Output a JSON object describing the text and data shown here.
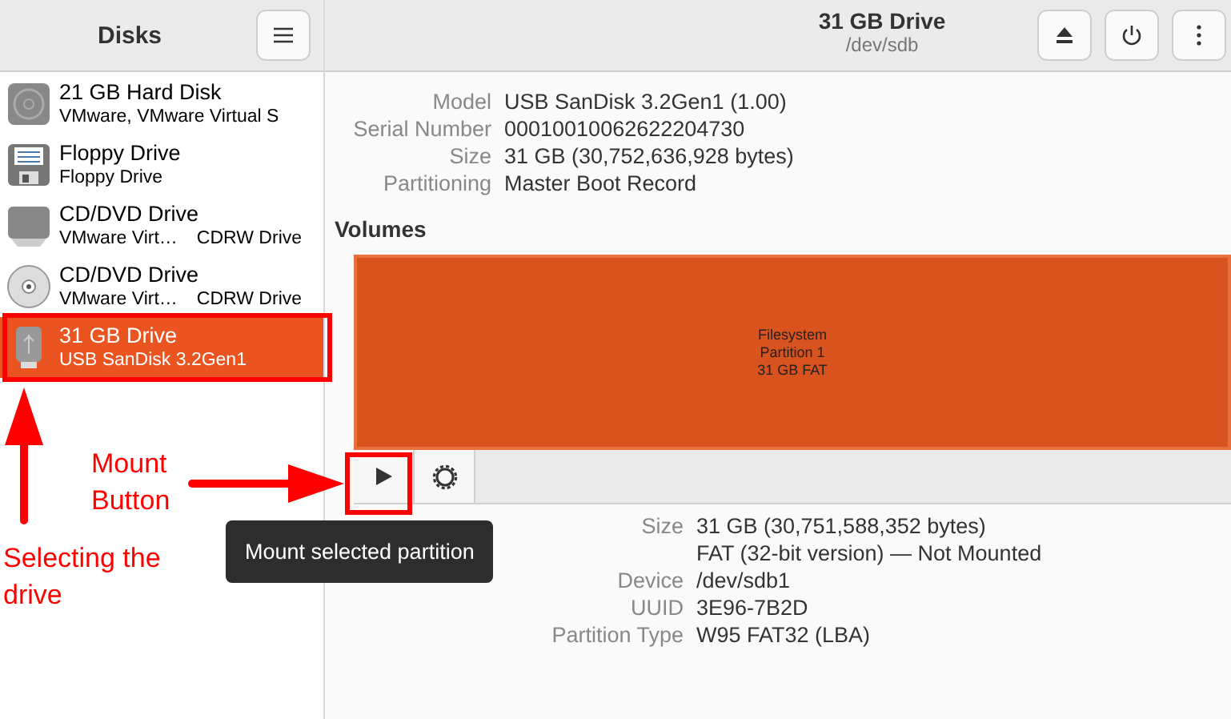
{
  "sidebar": {
    "title": "Disks",
    "items": [
      {
        "kind": "disk",
        "name": "21 GB Hard Disk",
        "subtitle": "VMware, VMware Virtual S",
        "selected": false
      },
      {
        "kind": "floppy",
        "name": "Floppy Drive",
        "subtitle": "Floppy Drive",
        "selected": false
      },
      {
        "kind": "tray",
        "name": "CD/DVD Drive",
        "subtitle": "VMware Virt…",
        "subtitle_2": "CDRW Drive",
        "selected": false
      },
      {
        "kind": "disc",
        "name": "CD/DVD Drive",
        "subtitle": "VMware Virt…",
        "subtitle_2": "CDRW Drive",
        "selected": false
      },
      {
        "kind": "usb",
        "name": "31 GB Drive",
        "subtitle": "USB SanDisk 3.2Gen1",
        "selected": true
      }
    ]
  },
  "header": {
    "title": "31 GB Drive",
    "subtitle": "/dev/sdb"
  },
  "drive_info": [
    {
      "label": "Model",
      "value": "USB SanDisk 3.2Gen1 (1.00)"
    },
    {
      "label": "Serial Number",
      "value": "00010010062622204730"
    },
    {
      "label": "Size",
      "value": "31 GB (30,752,636,928 bytes)"
    },
    {
      "label": "Partitioning",
      "value": "Master Boot Record"
    }
  ],
  "volumes": {
    "heading": "Volumes",
    "partition": [
      "Filesystem",
      "Partition 1",
      "31 GB FAT"
    ]
  },
  "partition_info": [
    {
      "label": "Size",
      "value": "31 GB (30,751,588,352 bytes)"
    },
    {
      "value": "FAT (32-bit version) — Not Mounted"
    },
    {
      "label": "Device",
      "value": "/dev/sdb1"
    },
    {
      "label": "UUID",
      "value": "3E96-7B2D"
    },
    {
      "label": "Partition Type",
      "value": "W95 FAT32 (LBA)"
    }
  ],
  "tooltip": "Mount selected partition",
  "annotations": {
    "mount_label": "Mount Button",
    "select_label": "Selecting the drive"
  }
}
